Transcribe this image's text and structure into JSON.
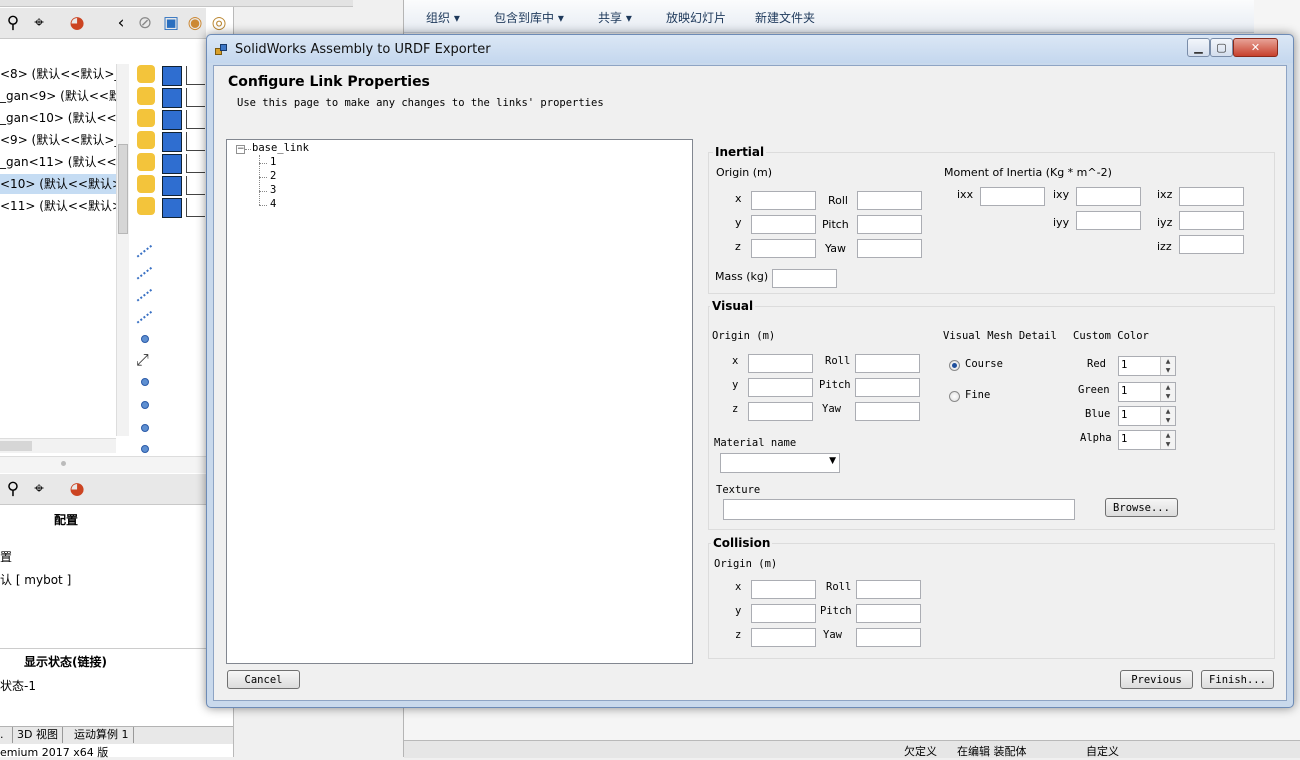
{
  "solidworks": {
    "tree_rows": [
      "<8> (默认<<默认>_显",
      "_gan<9> (默认<<默",
      "_gan<10> (默认<<默",
      "<9> (默认<<默认>_显",
      "_gan<11> (默认<<默",
      "<10> (默认<<默认>_",
      "<11> (默认<<默认>_"
    ],
    "panel_title": "配置",
    "config_heading": "置",
    "config_value": "认 [ mybot ]",
    "display_state_heading": "显示状态(链接)",
    "display_state_value": "状态-1",
    "bottom_tabs": [
      ".",
      "3D 视图",
      "运动算例 1"
    ],
    "status_left": "emium 2017 x64 版",
    "status_items": [
      "欠定义",
      "在编辑 装配体",
      "自定义"
    ]
  },
  "explorer": {
    "toolbar": [
      "组织 ▾",
      "包含到库中 ▾",
      "共享 ▾",
      "放映幻灯片",
      "新建文件夹"
    ]
  },
  "dialog": {
    "title": "SolidWorks Assembly to URDF Exporter",
    "header": "Configure Link Properties",
    "subtitle": "Use this page to make any changes to the links' properties",
    "tree": {
      "root": "base_link",
      "children": [
        "1",
        "2",
        "3",
        "4"
      ]
    },
    "inertial": {
      "title": "Inertial",
      "origin_label": "Origin (m)",
      "moment_label": "Moment of Inertia (Kg * m^-2)",
      "x": "x",
      "y": "y",
      "z": "z",
      "roll": "Roll",
      "pitch": "Pitch",
      "yaw": "Yaw",
      "ixx": "ixx",
      "ixy": "ixy",
      "ixz": "ixz",
      "iyy": "iyy",
      "iyz": "iyz",
      "izz": "izz",
      "mass_label": "Mass (kg)"
    },
    "visual": {
      "title": "Visual",
      "origin_label": "Origin (m)",
      "x": "x",
      "y": "y",
      "z": "z",
      "roll": "Roll",
      "pitch": "Pitch",
      "yaw": "Yaw",
      "mesh_detail_label": "Visual Mesh Detail",
      "course": "Course",
      "fine": "Fine",
      "mesh_detail_selected": "Course",
      "custom_color_label": "Custom Color",
      "red": "Red",
      "green": "Green",
      "blue": "Blue",
      "alpha": "Alpha",
      "red_value": "1",
      "green_value": "1",
      "blue_value": "1",
      "alpha_value": "1",
      "material_label": "Material name",
      "material_value": "",
      "texture_label": "Texture",
      "texture_value": "",
      "browse": "Browse..."
    },
    "collision": {
      "title": "Collision",
      "origin_label": "Origin (m)",
      "x": "x",
      "y": "y",
      "z": "z",
      "roll": "Roll",
      "pitch": "Pitch",
      "yaw": "Yaw"
    },
    "buttons": {
      "cancel": "Cancel",
      "previous": "Previous",
      "finish": "Finish..."
    }
  }
}
